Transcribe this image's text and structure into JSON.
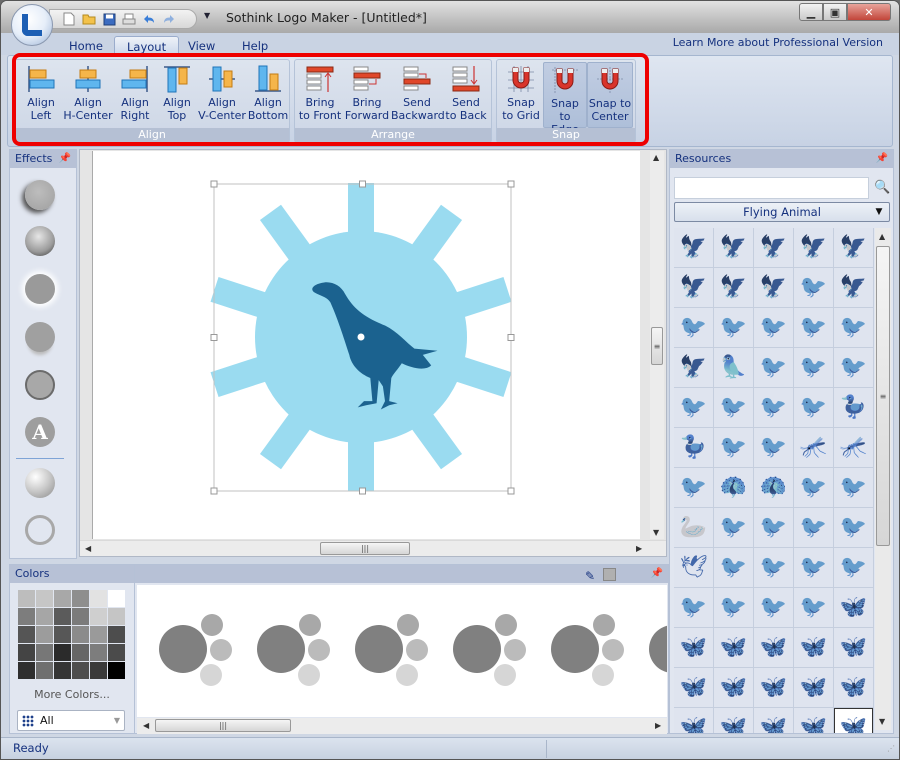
{
  "window": {
    "title": "Sothink Logo Maker - [Untitled*]",
    "controls": [
      "minimize",
      "maximize",
      "close"
    ]
  },
  "quick_access": [
    "new-file",
    "open-folder",
    "save",
    "print",
    "undo",
    "redo"
  ],
  "tabs": [
    {
      "label": "Home",
      "active": false
    },
    {
      "label": "Layout",
      "active": true
    },
    {
      "label": "View",
      "active": false
    },
    {
      "label": "Help",
      "active": false
    }
  ],
  "learn_more": "Learn More about Professional Version",
  "ribbon": {
    "align": {
      "label": "Align",
      "buttons": [
        {
          "l1": "Align",
          "l2": "Left"
        },
        {
          "l1": "Align",
          "l2": "H-Center"
        },
        {
          "l1": "Align",
          "l2": "Right"
        },
        {
          "l1": "Align",
          "l2": "Top"
        },
        {
          "l1": "Align",
          "l2": "V-Center"
        },
        {
          "l1": "Align",
          "l2": "Bottom"
        }
      ]
    },
    "arrange": {
      "label": "Arrange",
      "buttons": [
        {
          "l1": "Bring",
          "l2": "to Front"
        },
        {
          "l1": "Bring",
          "l2": "Forward"
        },
        {
          "l1": "Send",
          "l2": "Backward"
        },
        {
          "l1": "Send",
          "l2": "to Back"
        }
      ]
    },
    "snap": {
      "label": "Snap",
      "buttons": [
        {
          "l1": "Snap",
          "l2": "to Grid",
          "pressed": false
        },
        {
          "l1": "Snap",
          "l2": "to Edge",
          "pressed": true
        },
        {
          "l1": "Snap to",
          "l2": "Center",
          "pressed": true
        }
      ]
    }
  },
  "effects": {
    "title": "Effects",
    "items": [
      "drop-shadow",
      "bevel",
      "outer-glow",
      "reflection",
      "stroke",
      "text-effect",
      "gradient",
      "outline"
    ]
  },
  "canvas": {
    "logo": {
      "sunburst_color": "#9adbf0",
      "bird_color": "#1b628f",
      "shape": "falcon-silhouette"
    }
  },
  "resources": {
    "title": "Resources",
    "search_value": "",
    "category": "Flying Animal",
    "items": [
      "eagle-head-outline",
      "eagle-flying",
      "eagle-wings-up",
      "hawk-landing",
      "eagle-gliding",
      "eagle-swooping",
      "eagle-head",
      "eagle-profile",
      "bird-diving",
      "falcon-perched",
      "bird-perched",
      "partridge",
      "songbird",
      "cormorant",
      "owl-flying",
      "falcon-on-branch",
      "parrot",
      "seagull",
      "sandpiper",
      "hoopoe",
      "plover",
      "long-tail-bird",
      "finch",
      "gull-flying",
      "goose",
      "duck",
      "sparrow",
      "swallow",
      "dragonfly-outline",
      "dragonfly",
      "quail",
      "peacock-fan",
      "peacock",
      "curlew",
      "kingfisher",
      "swan",
      "pterodactyl",
      "swift",
      "roadrunner",
      "crow",
      "dove-pair",
      "seahorse-bird",
      "bird-on-branch",
      "magpie",
      "bird-on-flower",
      "hummingbird",
      "crane-flying",
      "bird-sitting",
      "seabird",
      "butterfly-ornate",
      "butterfly-lace",
      "butterfly-side",
      "butterfly-filigree",
      "butterfly-spotted",
      "butterfly-decor",
      "moth-side",
      "butterfly-solid",
      "swallowtail",
      "butterfly-resting",
      "butterfly-wide",
      "butterfly-a",
      "butterfly-b",
      "butterfly-c",
      "butterfly-d",
      "butterfly-e"
    ],
    "selected_index": 64
  },
  "colors": {
    "title": "Colors",
    "swatches": [
      "#bdbdbd",
      "#c6c6c6",
      "#a8a8a8",
      "#8e8e8e",
      "#e2e2e2",
      "#ffffff",
      "#7d7d7d",
      "#a6a6a6",
      "#5b5b5b",
      "#7b7b7b",
      "#cfcfcf",
      "#c5c5c5",
      "#555555",
      "#9c9c9c",
      "#575757",
      "#8b8b8b",
      "#9a9a9a",
      "#4d4d4d",
      "#444444",
      "#777777",
      "#2b2b2b",
      "#666666",
      "#7d7d7d",
      "#4b4b4b",
      "#2f2f2f",
      "#6f6f6f",
      "#353535",
      "#4e4e4e",
      "#3a3a3a",
      "#000000"
    ],
    "more_colors": "More Colors...",
    "filter_value": "All"
  },
  "palette": {
    "schemes": [
      {
        "main": "#808080",
        "dots": [
          "#a8a8a8",
          "#bbbbbb",
          "#d6d6d6"
        ]
      },
      {
        "main": "#808080",
        "dots": [
          "#a8a8a8",
          "#bbbbbb",
          "#d6d6d6"
        ]
      },
      {
        "main": "#808080",
        "dots": [
          "#a8a8a8",
          "#bbbbbb",
          "#d6d6d6"
        ]
      },
      {
        "main": "#808080",
        "dots": [
          "#a8a8a8",
          "#bbbbbb",
          "#d6d6d6"
        ]
      },
      {
        "main": "#808080",
        "dots": [
          "#a8a8a8",
          "#bbbbbb",
          "#d6d6d6"
        ]
      },
      {
        "main": "#808080",
        "dots": [
          "#a8a8a8",
          "#bbbbbb",
          "#d6d6d6"
        ]
      }
    ],
    "current_color": "#b0b0b0"
  },
  "status": {
    "text": "Ready"
  }
}
